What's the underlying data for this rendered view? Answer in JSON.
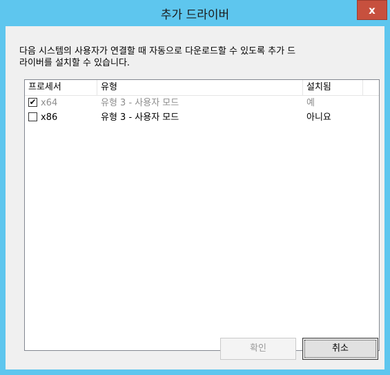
{
  "window": {
    "title": "추가 드라이버",
    "close_glyph": "x",
    "accent_color": "#5ec6ee",
    "close_color": "#c7503e"
  },
  "description": "다음 시스템의 사용자가 연결할 때 자동으로 다운로드할 수 있도록 추가 드\n라이버를 설치할 수 있습니다.",
  "list": {
    "columns": [
      "프로세서",
      "유형",
      "설치됨"
    ],
    "rows": [
      {
        "checked": true,
        "disabled": true,
        "processor": "x64",
        "type": "유형 3 - 사용자 모드",
        "installed": "예"
      },
      {
        "checked": false,
        "disabled": false,
        "processor": "x86",
        "type": "유형 3 - 사용자 모드",
        "installed": "아니요"
      }
    ]
  },
  "buttons": {
    "ok": "확인",
    "cancel": "취소"
  }
}
